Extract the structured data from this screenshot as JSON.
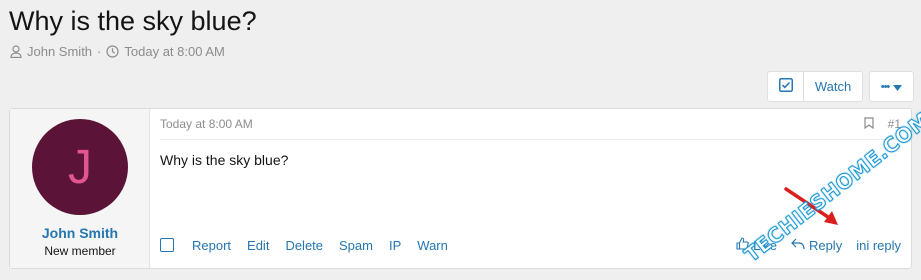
{
  "thread": {
    "title": "Why is the sky blue?",
    "author": "John Smith",
    "date": "Today at 8:00 AM"
  },
  "toolbar": {
    "watch_label": "Watch",
    "more_label": "•••"
  },
  "post": {
    "user": {
      "avatar_letter": "J",
      "name": "John Smith",
      "title": "New member"
    },
    "date": "Today at 8:00 AM",
    "number": "#1",
    "body": "Why is the sky blue?",
    "actions": {
      "report": "Report",
      "edit": "Edit",
      "delete": "Delete",
      "spam": "Spam",
      "ip": "IP",
      "warn": "Warn",
      "like": "Like",
      "reply": "Reply",
      "mini_reply": "ini reply"
    }
  },
  "watermark": "TECHIESHOME.COM",
  "colors": {
    "link": "#2577b1",
    "avatar_bg": "#5c1338",
    "avatar_fg": "#e2568f",
    "arrow": "#d9201f",
    "watermark": "#1a9ad6"
  }
}
